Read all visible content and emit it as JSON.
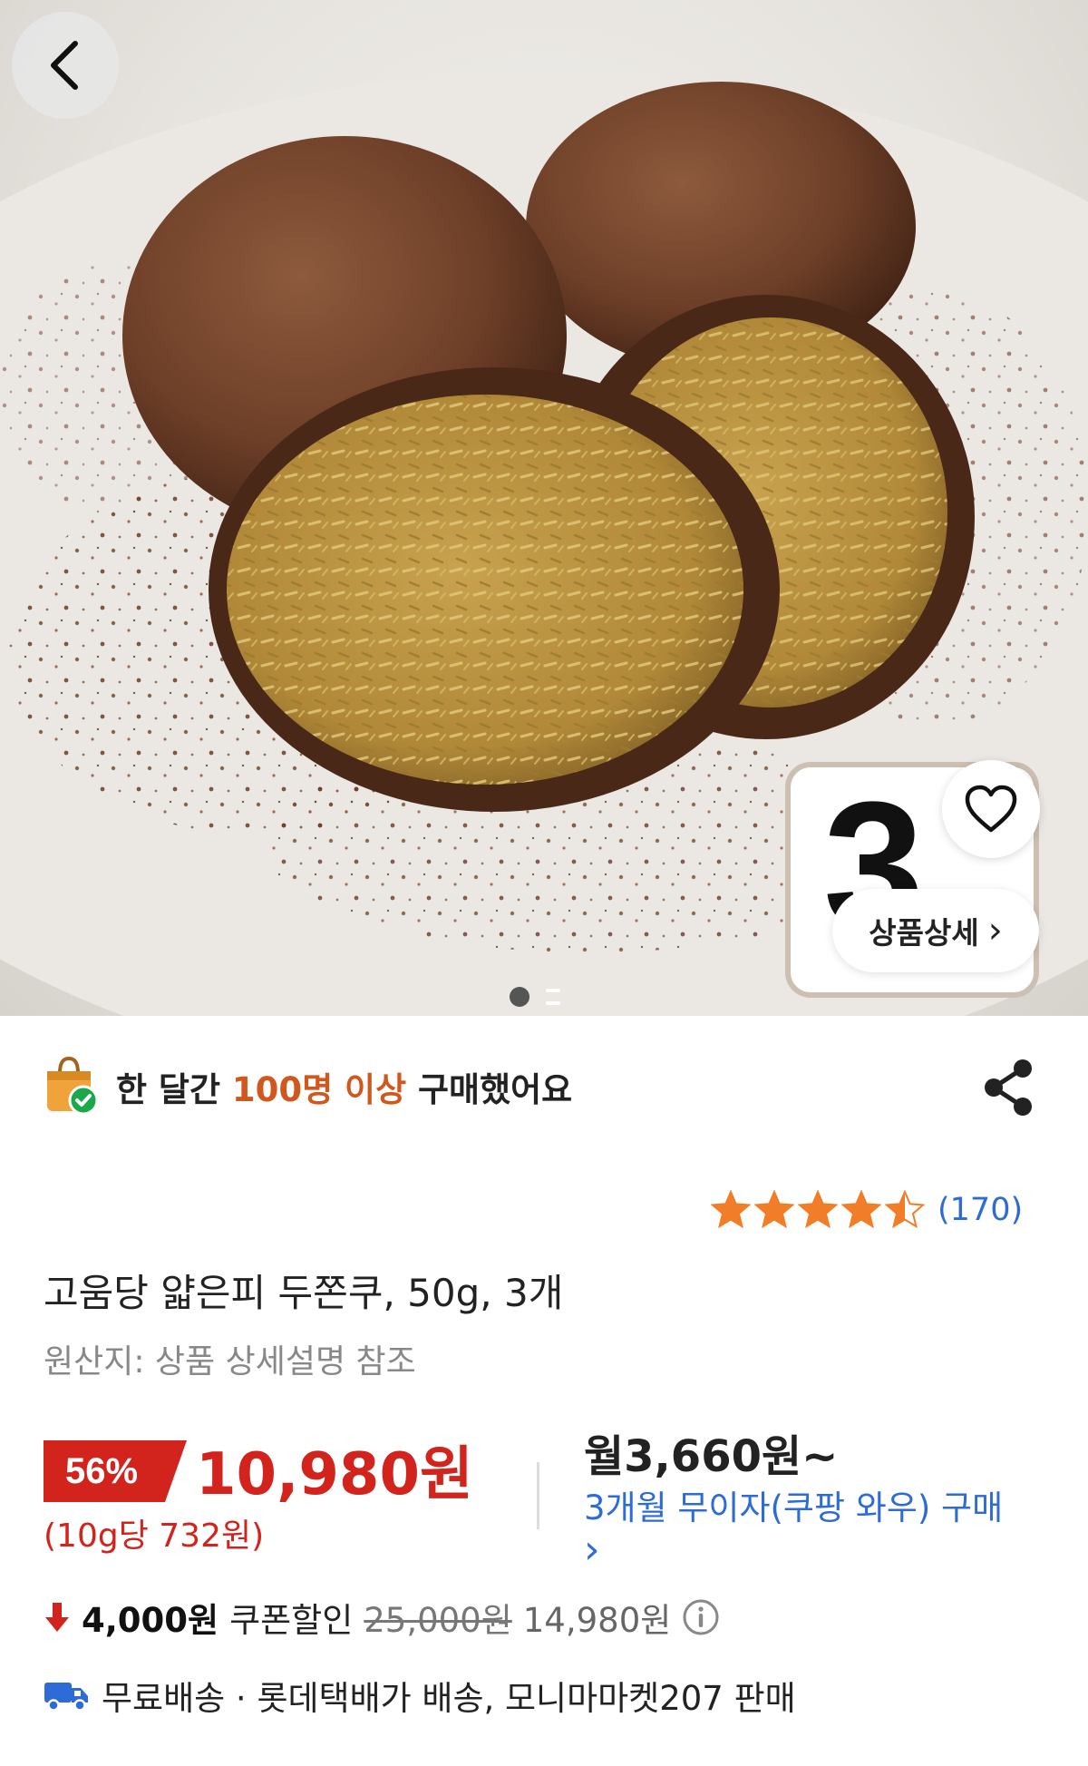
{
  "hero": {
    "thumbnail_text": "3",
    "detail_button_label": "상품상세",
    "detail_button_chevron": "›"
  },
  "social_proof": {
    "prefix": "한 달간 ",
    "highlight": "100명 이상",
    "suffix": " 구매했어요"
  },
  "rating": {
    "value": 4.5,
    "max": 5,
    "count_text": "(170)"
  },
  "product": {
    "title": "고움당 얇은피 두쫀쿠, 50g, 3개",
    "origin": "원산지: 상품 상세설명 참조"
  },
  "price": {
    "discount": "56%",
    "sale_price": "10,980원",
    "unit_price": "(10g당 732원)",
    "monthly": "월3,660원~",
    "installment": "3개월 무이자(쿠팡 와우) 구매",
    "installment_chevron": "›"
  },
  "coupon": {
    "amount": "4,000원",
    "label": "쿠폰할인",
    "original_price": "25,000원",
    "final_price": "14,980원"
  },
  "shipping": {
    "text": "무료배송 · 롯데택배가 배송, 모니마마켓207 판매"
  },
  "colors": {
    "accent_red": "#d2231c",
    "accent_orange": "#d0581d",
    "link_blue": "#2d6bd6",
    "star": "#f27d28"
  },
  "icons": [
    "back-icon",
    "heart-icon",
    "shopping-bag-check-icon",
    "share-icon",
    "star-icon",
    "arrow-down-icon",
    "info-icon",
    "truck-icon"
  ]
}
